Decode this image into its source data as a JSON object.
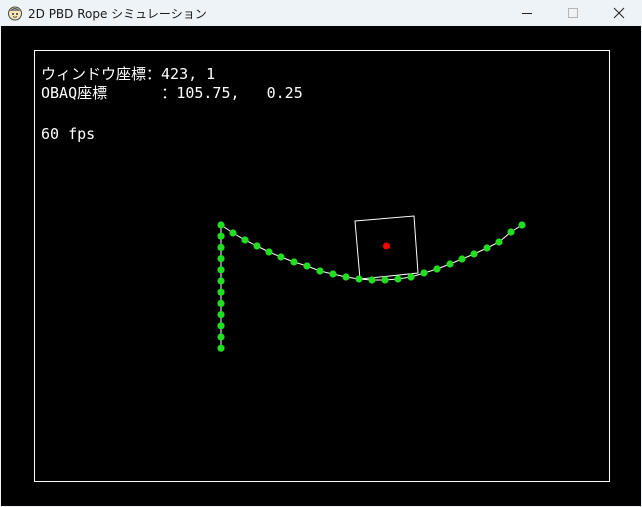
{
  "window": {
    "title": "2D PBD Rope シミュレーション"
  },
  "hud": {
    "window_coord_label": "ウィンドウ座標：",
    "window_coord_value": "423, 1",
    "obaq_coord_label": "OBAQ座標      ：",
    "obaq_coord_value": "105.75,   0.25",
    "fps_text": "60 fps"
  },
  "colors": {
    "background": "#000000",
    "frame": "#ffffff",
    "particle": "#22dd22",
    "rope": "#ffffff",
    "box": "#ffffff",
    "box_center": "#ff0000",
    "text": "#ffffff"
  },
  "icons": {
    "app": "app-icon",
    "minimize": "minimize-icon",
    "maximize": "maximize-icon",
    "close": "close-icon"
  }
}
